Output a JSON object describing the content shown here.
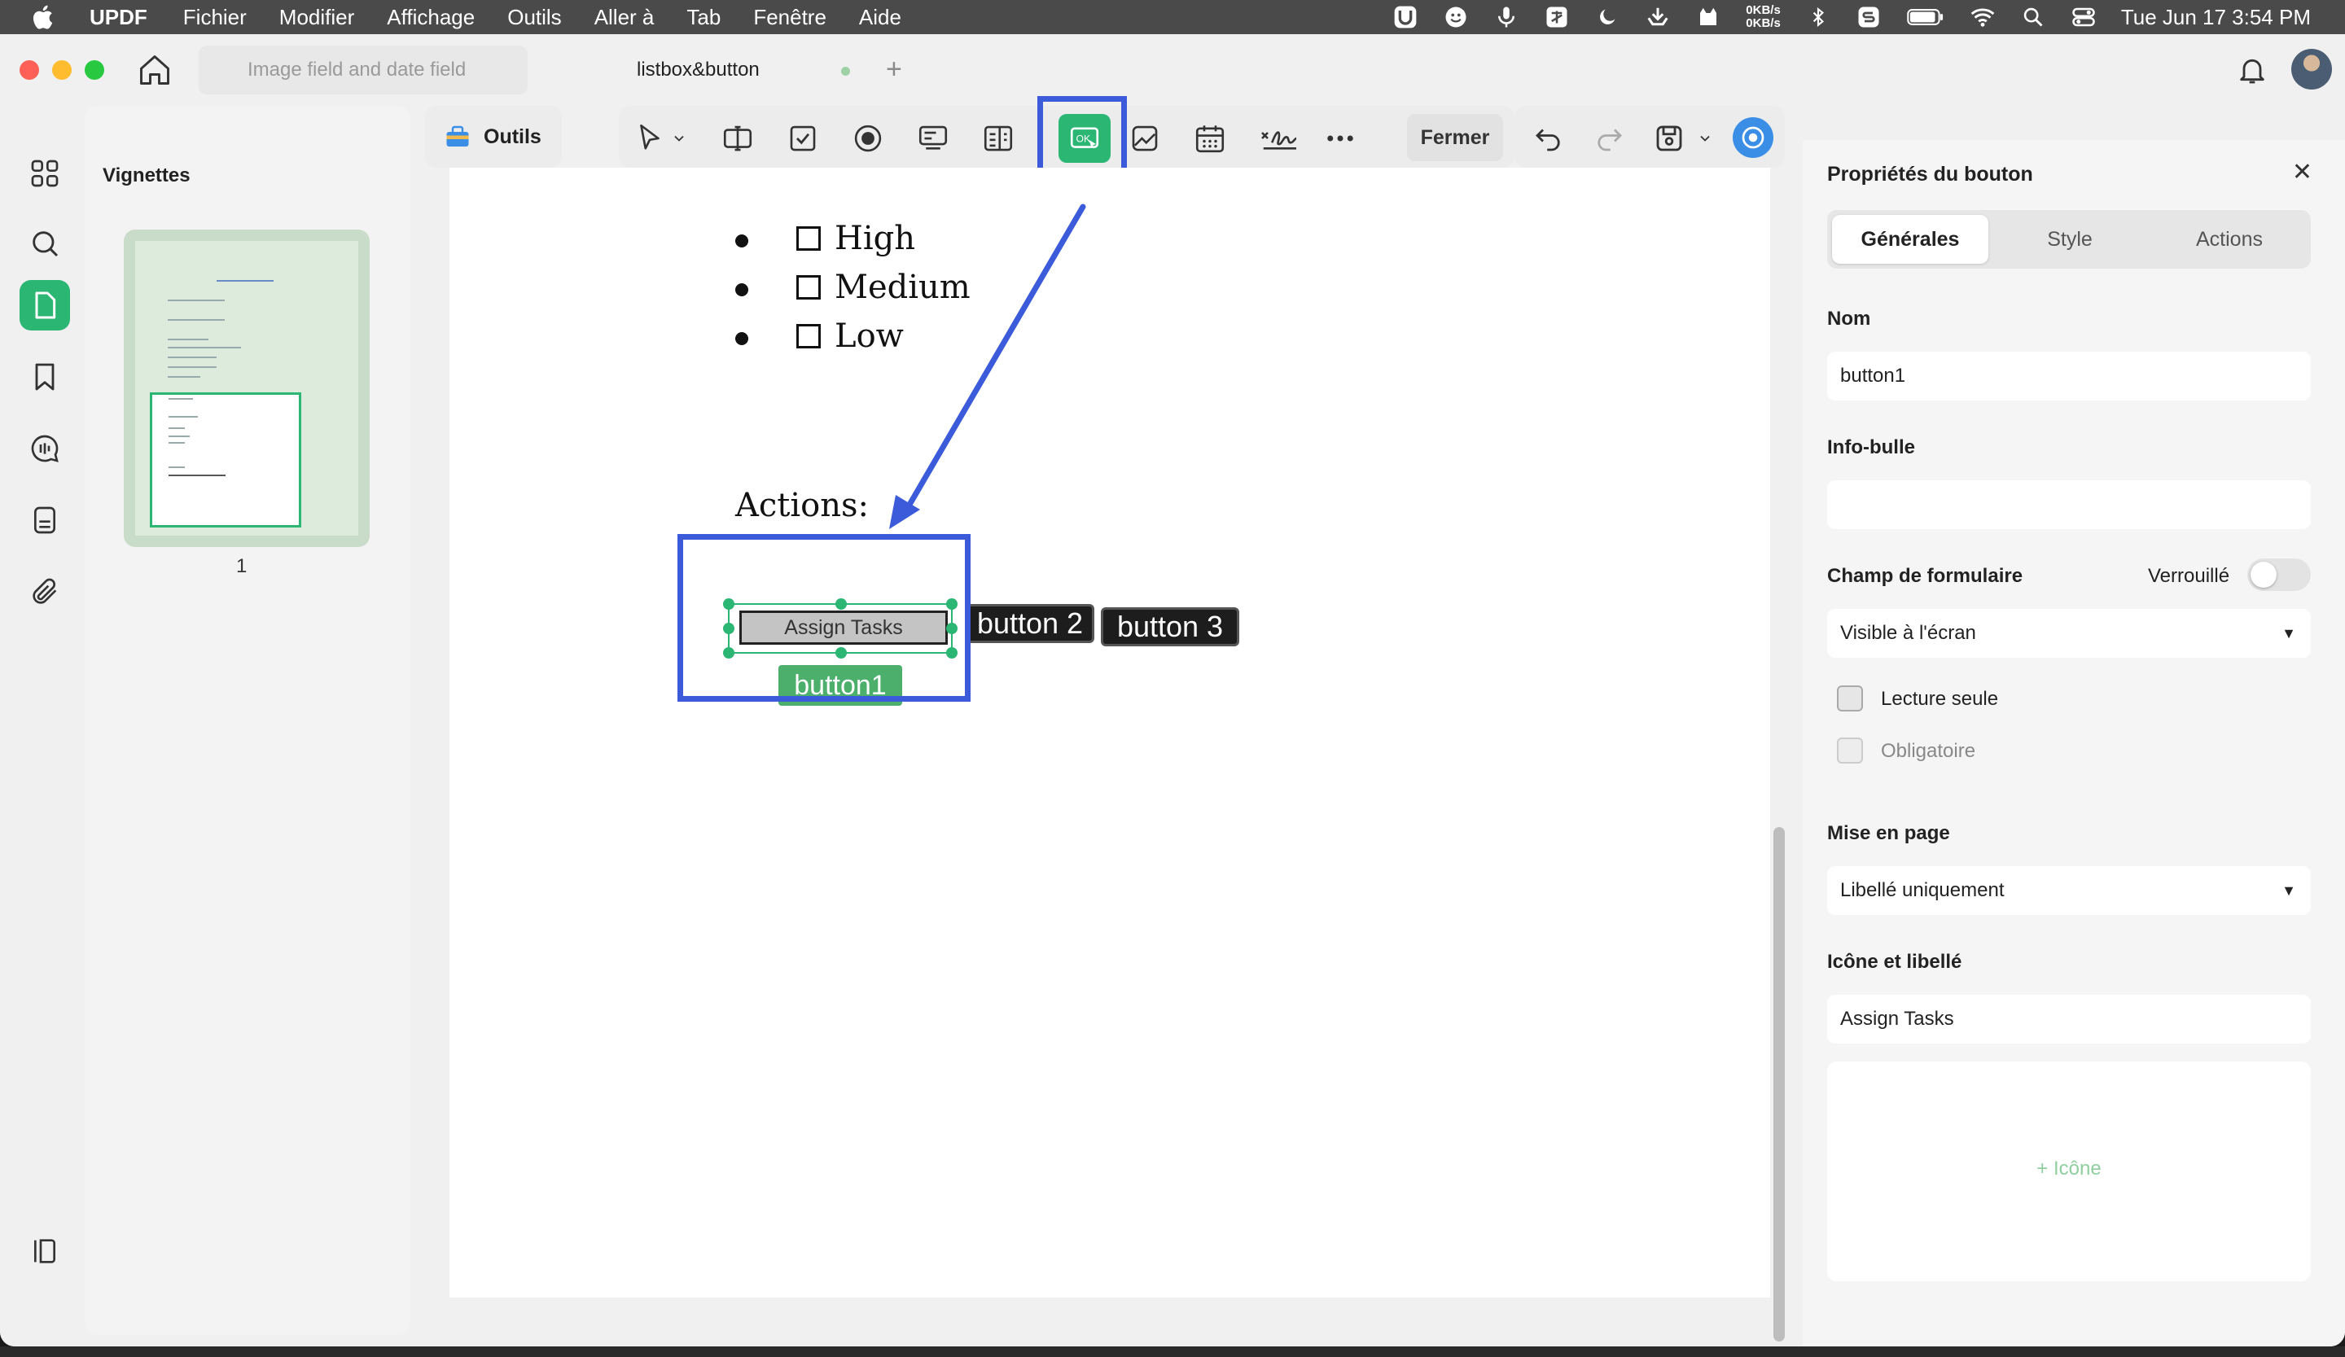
{
  "menubar": {
    "app": "UPDF",
    "items": [
      "Fichier",
      "Modifier",
      "Affichage",
      "Outils",
      "Aller à",
      "Tab",
      "Fenêtre",
      "Aide"
    ],
    "net_up": "0KB/s",
    "net_down": "0KB/s",
    "datetime": "Tue Jun 17  3:54 PM"
  },
  "tabs": {
    "inactive": "Image field and date field",
    "active": "listbox&button"
  },
  "thumbnails": {
    "title": "Vignettes",
    "page_number": "1"
  },
  "toolbar": {
    "tools_label": "Outils",
    "close_label": "Fermer"
  },
  "document": {
    "priority_options": [
      "High",
      "Medium",
      "Low"
    ],
    "actions_heading": "Actions:",
    "button1_caption": "Assign Tasks",
    "button1_name": "button1",
    "button2_caption": "button 2",
    "button3_caption": "button 3"
  },
  "properties": {
    "title": "Propriétés du bouton",
    "tabs": [
      "Générales",
      "Style",
      "Actions"
    ],
    "name_label": "Nom",
    "name_value": "button1",
    "tooltip_label": "Info-bulle",
    "tooltip_value": "",
    "form_field_label": "Champ de formulaire",
    "locked_label": "Verrouillé",
    "visibility_value": "Visible à l'écran",
    "readonly_label": "Lecture seule",
    "required_label": "Obligatoire",
    "layout_label": "Mise en page",
    "layout_value": "Libellé uniquement",
    "icon_label_heading": "Icône et libellé",
    "label_value": "Assign Tasks",
    "add_icon_label": "+ Icône"
  },
  "colors": {
    "accent_green": "#2bb673",
    "highlight_blue": "#3b5bdb"
  }
}
